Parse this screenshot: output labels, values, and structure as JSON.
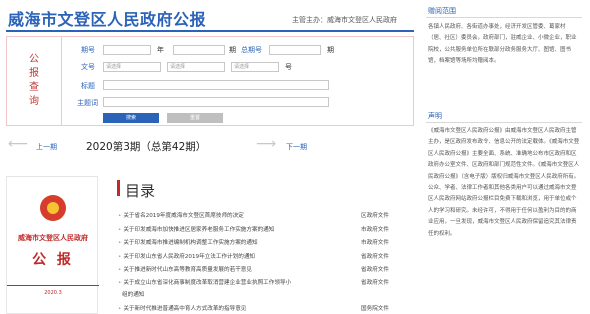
{
  "header": {
    "title": "威海市文登区人民政府公报",
    "sponsor": "主管主办：威海市文登区人民政府"
  },
  "search": {
    "side_label": "公\n报\n查\n询",
    "issue_label": "期号",
    "year_label": "年",
    "period_label": "期",
    "total_label": "总期号",
    "total_suffix": "期",
    "doc_label": "文号",
    "doc_placeholder_1": "请选择",
    "doc_placeholder_2": "请选择",
    "doc_placeholder_3": "请选择",
    "doc_suffix": "号",
    "title_label": "标题",
    "keyword_label": "主题词",
    "search_button": "搜索",
    "reset_button": "重置"
  },
  "nav": {
    "prev_label": "上一期",
    "issue_title": "2020第3期（总第42期）",
    "next_label": "下一期"
  },
  "cover": {
    "title": "威海市文登区人民政府",
    "big": "公 报",
    "issue": "2020.3"
  },
  "toc": {
    "title": "目录",
    "items": [
      {
        "text": "关于省名2019年度威海市文登区首席技师的决定",
        "source": "区政府文件"
      },
      {
        "text": "关于印发威海市加快推进区居家养老服务工作实施方案的通知",
        "source": "市政府文件"
      },
      {
        "text": "关于印发威海市推进编制机构调整工作实施方案的通知",
        "source": "市政府文件"
      },
      {
        "text": "关于印发山东省人民政府2019年立法工作计划的通知",
        "source": "省政府文件"
      },
      {
        "text": "关于推进新时代山东高等教育高质量发展的若干意见",
        "source": "省政府文件"
      },
      {
        "text": "关于成立山东省深化商事制度改革取消营建企业营业执照工作领导小",
        "source": "省政府文件"
      },
      {
        "text": "组的通知",
        "source": ""
      },
      {
        "text": "关于新时代推进普通高中育人方式改革的指导意见",
        "source": "国务院文件"
      }
    ]
  },
  "right": {
    "scope_title": "赠阅范围",
    "scope_text": [
      "各镇人民政府、各街道办事处，经济开发区管委、葛家村（居、社区）委员会，政府部门，驻威企业、小微企业，职业院校，公共服务单位所在联部分政务服务大厅、图馆、图书馆，档案馆等场所均赠阅本。"
    ],
    "statement_title": "声明",
    "statement_text": [
      "《威海市文登区人民政府公报》由威海市文登区人民政府主管主办，是区政府发布政令、信息公开的法定载体。《威海市文登区人民政府公报》主要全面、系统、准确地公布市区政府和区政府办公室文件、区政府和部门规范性文件。《威海市文登区人民政府公报》（含电子版）版权归威海市文登区人民政府所有。公众、学者、法律工作者和其他各类用户可以通过威海市文登区人民政府网站政府公报栏目免费下载和浏览，用于单位或个人的学习和研究。未经许可，不得用于任何以盈利为目的的商业应用，一旦发现，威海市文登区人民政府保留追究其法律责任的权利。"
    ]
  },
  "colors": {
    "accent": "#2b63b8",
    "brand_red": "#c02a2a",
    "button_blue": "#2b63b8",
    "button_gray": "#bfbfbf"
  }
}
